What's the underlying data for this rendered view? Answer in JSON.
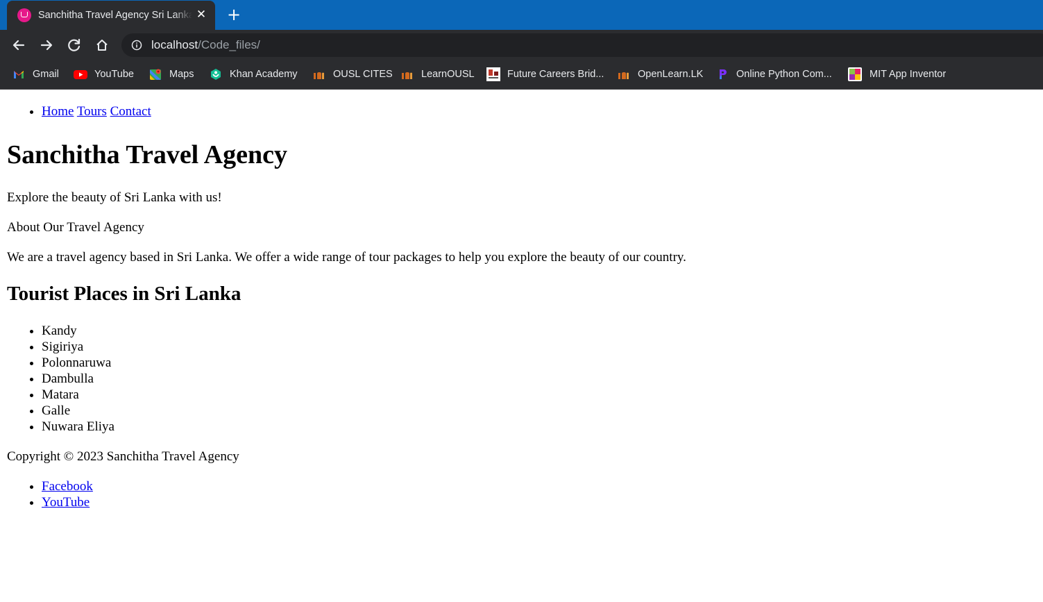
{
  "browser": {
    "tab": {
      "title": "Sanchitha Travel Agency Sri Lanka",
      "close_icon": "close-icon",
      "favicon": "site-favicon"
    },
    "new_tab_glyph": "+",
    "url": {
      "host": "localhost",
      "path": "/Code_files/"
    },
    "bookmarks": [
      {
        "label": "Gmail",
        "icon": "gmail-icon"
      },
      {
        "label": "YouTube",
        "icon": "youtube-icon"
      },
      {
        "label": "Maps",
        "icon": "maps-icon"
      },
      {
        "label": "Khan Academy",
        "icon": "khan-academy-icon"
      },
      {
        "label": "OUSL CITES",
        "icon": "ousl-icon"
      },
      {
        "label": "LearnOUSL",
        "icon": "ousl-icon"
      },
      {
        "label": "Future Careers Brid...",
        "icon": "future-careers-icon"
      },
      {
        "label": "OpenLearn.LK",
        "icon": "ousl-icon"
      },
      {
        "label": "Online Python Com...",
        "icon": "python-compiler-icon"
      },
      {
        "label": "MIT App Inventor",
        "icon": "mit-app-inventor-icon"
      }
    ],
    "colors": {
      "tabstrip": "#0b67b8",
      "toolbar": "#2b2c2f",
      "omnibox": "#202124"
    }
  },
  "page": {
    "nav": [
      {
        "label": "Home"
      },
      {
        "label": "Tours"
      },
      {
        "label": "Contact"
      }
    ],
    "title": "Sanchitha Travel Agency",
    "tagline": "Explore the beauty of Sri Lanka with us!",
    "about_heading": "About Our Travel Agency",
    "about_text": "We are a travel agency based in Sri Lanka. We offer a wide range of tour packages to help you explore the beauty of our country.",
    "places_heading": "Tourist Places in Sri Lanka",
    "places": [
      "Kandy",
      "Sigiriya",
      "Polonnaruwa",
      "Dambulla",
      "Matara",
      "Galle",
      "Nuwara Eliya"
    ],
    "copyright": "Copyright © 2023 Sanchitha Travel Agency",
    "social": [
      {
        "label": "Facebook"
      },
      {
        "label": "YouTube"
      }
    ],
    "link_color": "#0000ee"
  }
}
